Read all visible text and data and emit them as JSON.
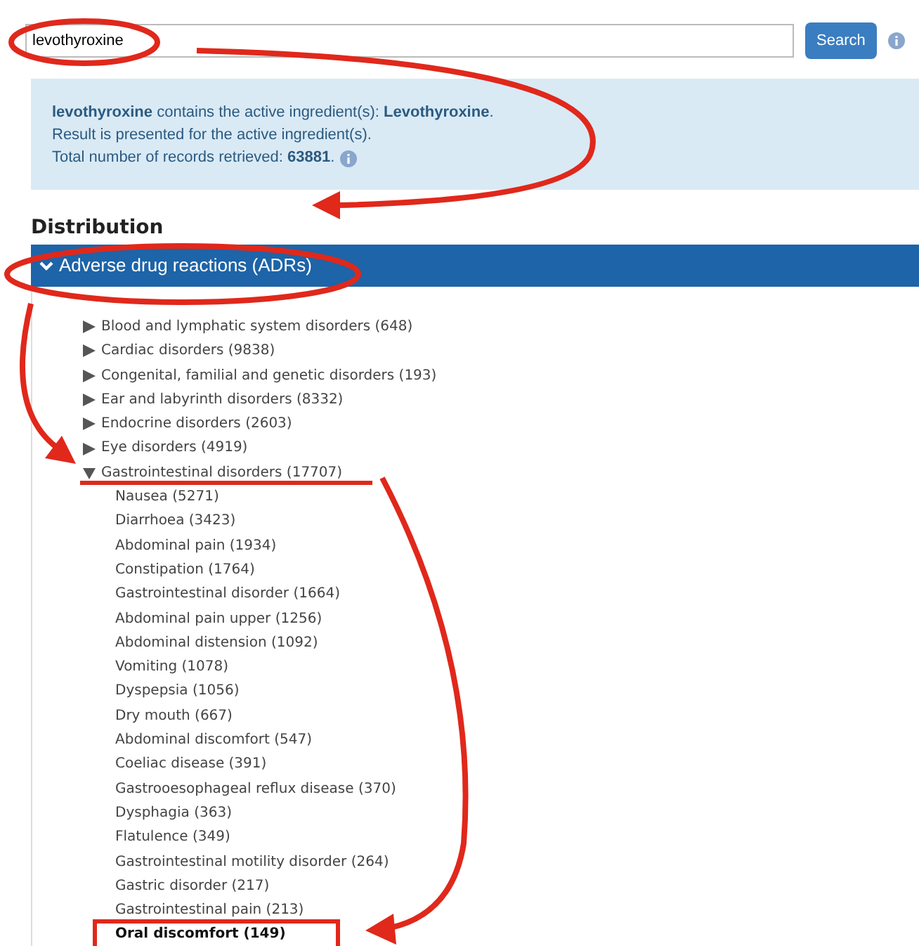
{
  "search": {
    "value": "levothyroxine",
    "button": "Search"
  },
  "info": {
    "lines": [
      "**levothyroxine** contains the active ingredient(s): **Levothyroxine**.",
      "Result is presented for the active ingredient(s).",
      "Total number of records retrieved: **63881**."
    ]
  },
  "section_title": "Distribution",
  "panel": {
    "title": "Adverse drug reactions (ADRs)",
    "expanded": true
  },
  "tree": [
    {
      "label": "Blood and lymphatic system disorders (648)",
      "expanded": false
    },
    {
      "label": "Cardiac disorders (9838)",
      "expanded": false
    },
    {
      "label": "Congenital, familial and genetic disorders (193)",
      "expanded": false
    },
    {
      "label": "Ear and labyrinth disorders (8332)",
      "expanded": false
    },
    {
      "label": "Endocrine disorders (2603)",
      "expanded": false
    },
    {
      "label": "Eye disorders (4919)",
      "expanded": false
    },
    {
      "label": "Gastrointestinal disorders (17707)",
      "expanded": true,
      "children": [
        {
          "label": "Nausea (5271)",
          "selected": false
        },
        {
          "label": "Diarrhoea (3423)",
          "selected": false
        },
        {
          "label": "Abdominal pain (1934)",
          "selected": false
        },
        {
          "label": "Constipation (1764)",
          "selected": false
        },
        {
          "label": "Gastrointestinal disorder (1664)",
          "selected": false
        },
        {
          "label": "Abdominal pain upper (1256)",
          "selected": false
        },
        {
          "label": "Abdominal distension (1092)",
          "selected": false
        },
        {
          "label": "Vomiting (1078)",
          "selected": false
        },
        {
          "label": "Dyspepsia (1056)",
          "selected": false
        },
        {
          "label": "Dry mouth (667)",
          "selected": false
        },
        {
          "label": "Abdominal discomfort (547)",
          "selected": false
        },
        {
          "label": "Coeliac disease (391)",
          "selected": false
        },
        {
          "label": "Gastrooesophageal reflux disease (370)",
          "selected": false
        },
        {
          "label": "Dysphagia (363)",
          "selected": false
        },
        {
          "label": "Flatulence (349)",
          "selected": false
        },
        {
          "label": "Gastrointestinal motility disorder (264)",
          "selected": false
        },
        {
          "label": "Gastric disorder (217)",
          "selected": false
        },
        {
          "label": "Gastrointestinal pain (213)",
          "selected": false
        },
        {
          "label": "Oral discomfort (149)",
          "selected": true
        }
      ]
    }
  ]
}
